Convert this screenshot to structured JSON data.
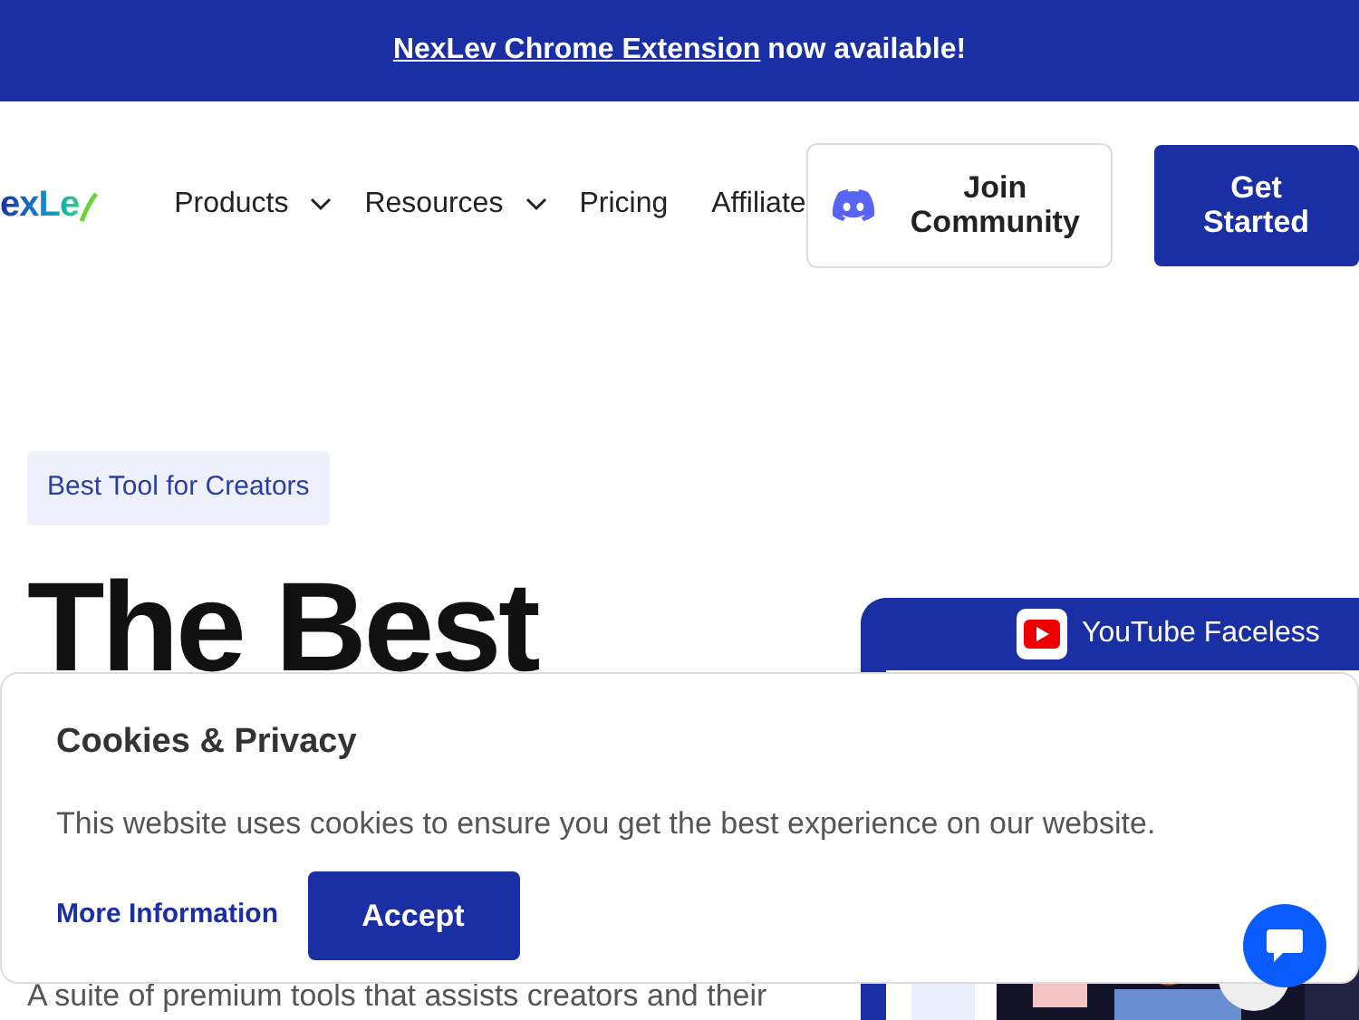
{
  "banner": {
    "link": "NexLev Chrome Extension",
    "text": "now available!"
  },
  "nav": {
    "logo": "exLe",
    "items": [
      {
        "label": "Products",
        "kind": "dropdown"
      },
      {
        "label": "Resources",
        "kind": "dropdown"
      },
      {
        "label": "Pricing",
        "kind": "link"
      },
      {
        "label": "Affiliate",
        "kind": "link"
      }
    ],
    "community_button": "Join Community",
    "cta_button": "Get Started"
  },
  "hero": {
    "badge": "Best Tool for Creators",
    "heading": "The Best",
    "description": "A suite of premium tools that assists creators and their"
  },
  "preview_card": {
    "title": "YouTube Faceless"
  },
  "cookie_banner": {
    "title": "Cookies & Privacy",
    "message": "This website uses cookies to ensure you get the best experience on our website.",
    "more_link": "More Information",
    "accept_button": "Accept"
  }
}
